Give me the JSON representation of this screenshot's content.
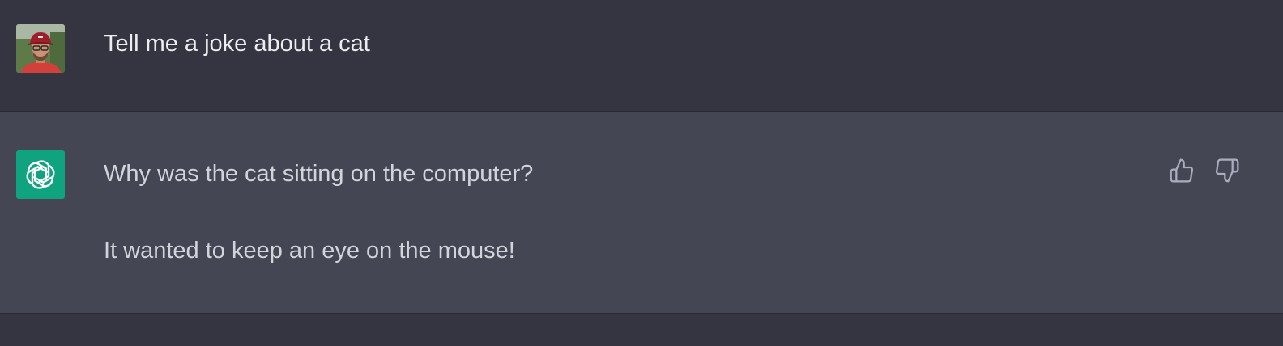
{
  "user_message": {
    "avatar_icon": "user-photo-avatar",
    "text": "Tell me a joke about a cat"
  },
  "assistant_message": {
    "avatar_icon": "openai-logo-icon",
    "avatar_color": "#10a37f",
    "paragraphs": [
      "Why was the cat sitting on the computer?",
      "It wanted to keep an eye on the mouse!"
    ],
    "feedback": {
      "up_icon": "thumbs-up-icon",
      "down_icon": "thumbs-down-icon"
    }
  },
  "colors": {
    "user_row_bg": "#343541",
    "assistant_row_bg": "#444654",
    "text": "#ececf1",
    "icon": "#acacbe"
  }
}
